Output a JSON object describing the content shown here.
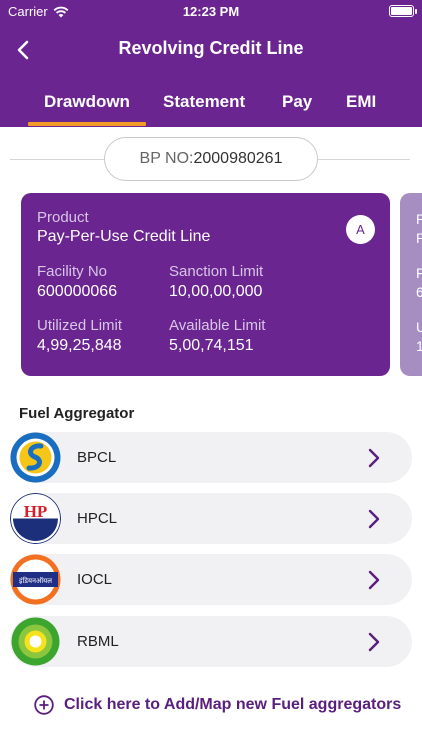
{
  "status_bar": {
    "carrier": "Carrier",
    "time": "12:23 PM"
  },
  "header": {
    "title": "Revolving Credit Line"
  },
  "tabs": [
    {
      "label": "Drawdown"
    },
    {
      "label": "Statement"
    },
    {
      "label": "Pay"
    },
    {
      "label": "EMI"
    }
  ],
  "bp": {
    "label": "BP NO:",
    "value": "2000980261"
  },
  "card": {
    "product_label": "Product",
    "product_value": "Pay-Per-Use Credit Line",
    "badge": "A",
    "facility_label": "Facility No",
    "facility_value": "600000066",
    "sanction_label": "Sanction Limit",
    "sanction_value": "10,00,00,000",
    "utilized_label": "Utilized Limit",
    "utilized_value": "4,99,25,848",
    "available_label": "Available Limit",
    "available_value": "5,00,74,151"
  },
  "section": {
    "title": "Fuel Aggregator"
  },
  "aggregators": [
    {
      "label": "BPCL",
      "icon": "bpcl-logo-icon"
    },
    {
      "label": "HPCL",
      "icon": "hpcl-logo-icon",
      "logo_text": "HP"
    },
    {
      "label": "IOCL",
      "icon": "iocl-logo-icon",
      "logo_text": "इंडियनऑयल"
    },
    {
      "label": "RBML",
      "icon": "bp-helios-logo-icon"
    }
  ],
  "add_link": {
    "label": "Click here to Add/Map new Fuel aggregators"
  },
  "colors": {
    "primary": "#6a2590",
    "accent": "#f29b28",
    "row_bg": "#f1f0f3"
  }
}
